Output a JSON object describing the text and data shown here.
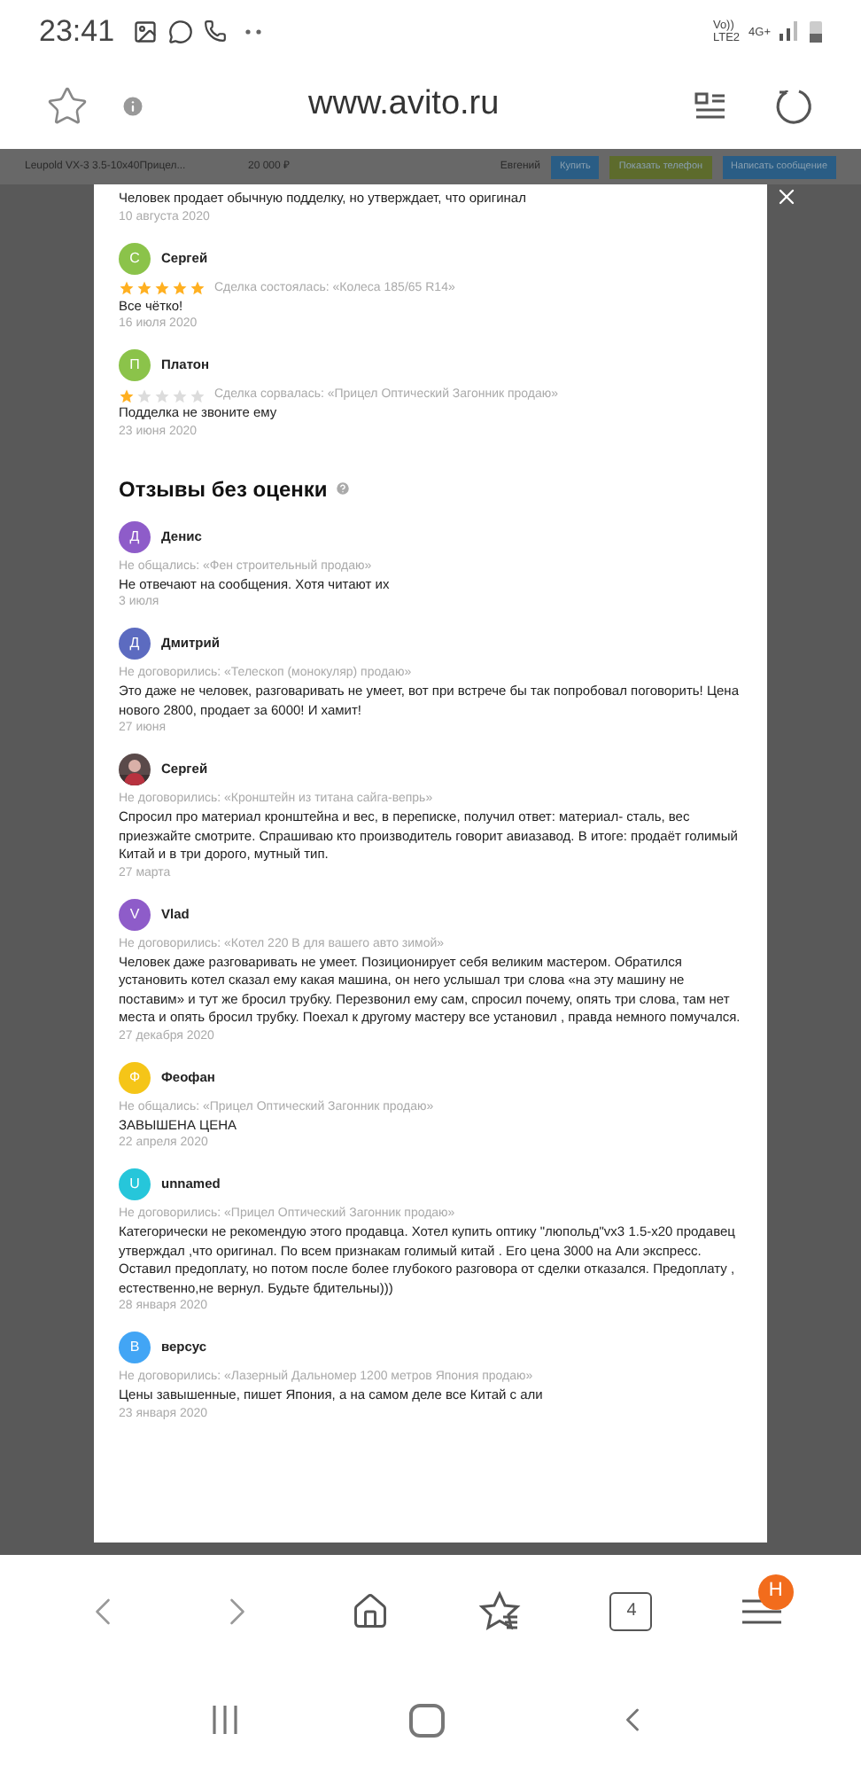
{
  "status_bar": {
    "time": "23:41",
    "volte": "Vo))",
    "lte": "LTE2",
    "network": "4G+"
  },
  "browser": {
    "url": "www.avito.ru",
    "tab_count": "4",
    "menu_badge": "H"
  },
  "listing_bar": {
    "title": "Leupold VX-3 3.5-10x40Прицел...",
    "price": "20 000 ₽",
    "seller": "Евгений",
    "buttons": [
      {
        "label": "Купить",
        "color": "#2a5d85"
      },
      {
        "label": "Показать телефон",
        "color": "#5d6b2c"
      },
      {
        "label": "Написать сообщение",
        "color": "#2a5d85"
      }
    ]
  },
  "reviews_dialog": {
    "partial_review": {
      "text": "Человек продает обычную подделку, но утверждает, что оригинал",
      "date": "10 августа 2020"
    },
    "rated_reviews": [
      {
        "initial": "С",
        "name": "Сергей",
        "color": "#8bc34a",
        "stars": 5,
        "deal": "Сделка состоялась: «Колеса 185/65 R14»",
        "text": "Все чётко!",
        "date": "16 июля 2020"
      },
      {
        "initial": "П",
        "name": "Платон",
        "color": "#8bc34a",
        "stars": 1,
        "deal": "Сделка сорвалась: «Прицел Оптический Загонник продаю»",
        "text": "Подделка не звоните ему",
        "date": "23 июня 2020"
      }
    ],
    "section_title": "Отзывы без оценки",
    "unrated_reviews": [
      {
        "kind": "letter",
        "initial": "Д",
        "name": "Денис",
        "color": "#8e5cc9",
        "deal": "Не общались: «Фен строительный продаю»",
        "text": "Не отвечают на сообщения. Хотя читают их",
        "date": "3 июля"
      },
      {
        "kind": "letter",
        "initial": "Д",
        "name": "Дмитрий",
        "color": "#5c6bc0",
        "deal": "Не договорились: «Телескоп (монокуляр) продаю»",
        "text": "Это даже не человек, разговаривать не умеет, вот при встрече бы так попробовал поговорить! Цена нового 2800, продает за 6000! И хамит!",
        "date": "27 июня"
      },
      {
        "name": "Сергей",
        "deal": "Не договорились: «Кронштейн из титана сайга-вепрь»",
        "text": "Спросил про материал кронштейна и вес, в переписке, получил ответ: материал- сталь, вес приезжайте смотрите. Спрашиваю кто производитель говорит авиазавод. В итоге: продаёт голимый Китай и в три дорого, мутный тип.",
        "date": "27 марта"
      },
      {
        "kind": "letter",
        "initial": "V",
        "name": "Vlad",
        "color": "#8e5cc9",
        "deal": "Не договорились: «Котел 220 В для вашего авто зимой»",
        "text": "Человек даже разговаривать не умеет. Позиционирует себя великим мастером. Обратился установить котел сказал ему какая машина, он него услышал три слова «на эту машину не поставим» и тут же бросил трубку. Перезвонил ему сам, спросил почему, опять три слова, там нет места и опять бросил трубку. Поехал к другому мастеру все установил , правда немного помучался.",
        "date": "27 декабря 2020"
      },
      {
        "kind": "letter",
        "initial": "Ф",
        "name": "Феофан",
        "color": "#f5c518",
        "deal": "Не общались: «Прицел Оптический Загонник продаю»",
        "text": "ЗАВЫШЕНА ЦЕНА",
        "date": "22 апреля 2020"
      },
      {
        "kind": "letter",
        "initial": "U",
        "name": "unnamed",
        "color": "#26c6da",
        "deal": "Не договорились: «Прицел Оптический Загонник продаю»",
        "text": "Категорически не рекомендую этого продавца. Хотел купить оптику \"люпольд\"vx3 1.5-x20 продавец утверждал ,что оригинал. По всем признакам голимый китай . Его цена 3000 на Али экспресс. Оставил предоплату, но потом после более глубокого разговора от сделки отказался. Предоплату , естественно,не вернул. Будьте бдительны)))",
        "date": "28 января 2020"
      },
      {
        "kind": "letter",
        "initial": "В",
        "name": "версус",
        "color": "#42a5f5",
        "deal": "Не договорились: «Лазерный Дальномер 1200 метров Япония продаю»",
        "text": "Цены завышенные, пишет Япония, а на самом деле все Китай с али",
        "date": "23 января 2020"
      }
    ]
  }
}
